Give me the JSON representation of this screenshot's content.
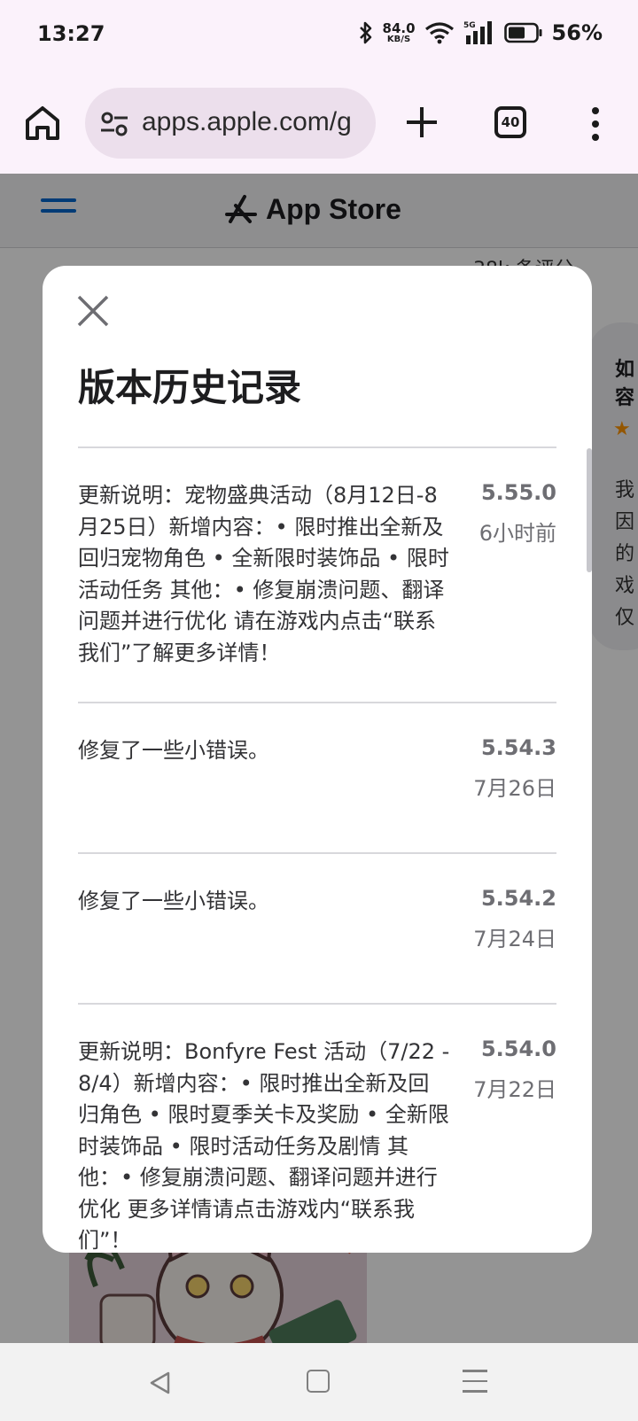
{
  "status_bar": {
    "time": "13:27",
    "net_speed_value": "84.0",
    "net_speed_unit": "KB/S",
    "network": "5G",
    "battery": "56%"
  },
  "browser": {
    "url": "apps.apple.com/g",
    "tab_count": "40"
  },
  "page": {
    "brand": "App Store",
    "background_rating": "38k 条评分",
    "background_card_title": "如容",
    "background_card_body": "我因的戏仅"
  },
  "modal": {
    "title": "版本历史记录",
    "entries": [
      {
        "note": "更新说明：宠物盛典活动（8月12日-8月25日）新增内容：• 限时推出全新及回归宠物角色 • 全新限时装饰品 • 限时活动任务 其他：• 修复崩溃问题、翻译问题并进行优化 请在游戏内点击“联系我们”了解更多详情！",
        "version": "5.55.0",
        "date": "6小时前"
      },
      {
        "note": "修复了一些小错误。",
        "version": "5.54.3",
        "date": "7月26日"
      },
      {
        "note": "修复了一些小错误。",
        "version": "5.54.2",
        "date": "7月24日"
      },
      {
        "note": "更新说明：Bonfyre Fest 活动（7/22 - 8/4）新增内容：• 限时推出全新及回归角色 • 限时夏季关卡及奖励 • 全新限时装饰品 • 限时活动任务及剧情 其他：• 修复崩溃问题、翻译问题并进行优化 更多详情请点击游戏内“联系我们”！",
        "version": "5.54.0",
        "date": "7月22日"
      }
    ]
  },
  "icons": {
    "close": "close-icon",
    "home": "home-icon",
    "site_settings": "tune-icon",
    "new_tab": "plus-icon",
    "overflow_menu": "more-vert-icon"
  }
}
